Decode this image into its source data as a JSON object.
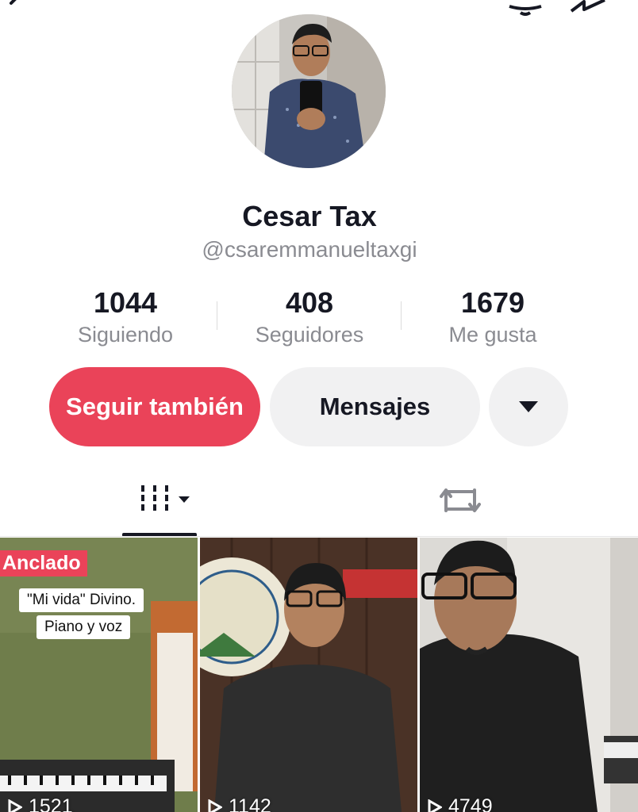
{
  "profile": {
    "name": "Cesar Tax",
    "handle": "@csaremmanueltaxgi"
  },
  "stats": [
    {
      "value": "1044",
      "label": "Siguiendo"
    },
    {
      "value": "408",
      "label": "Seguidores"
    },
    {
      "value": "1679",
      "label": "Me gusta"
    }
  ],
  "actions": {
    "follow_label": "Seguir también",
    "message_label": "Mensajes"
  },
  "tabs": {
    "videos_icon": "grid-icon",
    "repost_icon": "repost-icon"
  },
  "videos": [
    {
      "badge": "Anclado",
      "caption_line1": "\"Mi vida\" Divino.",
      "caption_line2": "Piano y voz",
      "views": "1521"
    },
    {
      "views": "1142"
    },
    {
      "views": "4749"
    }
  ],
  "colors": {
    "accent": "#ea4359",
    "secondary_button": "#f1f1f2"
  }
}
